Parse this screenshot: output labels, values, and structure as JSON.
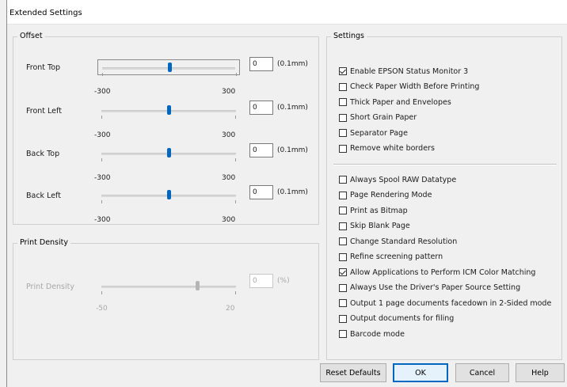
{
  "window": {
    "title": "Extended Settings"
  },
  "offset": {
    "group_label": "Offset",
    "rows": [
      {
        "label": "Front Top",
        "value": "0",
        "unit": "(0.1mm)",
        "min": "-300",
        "max": "300",
        "level": 0.5
      },
      {
        "label": "Front Left",
        "value": "0",
        "unit": "(0.1mm)",
        "min": "-300",
        "max": "300",
        "level": 0.5
      },
      {
        "label": "Back Top",
        "value": "0",
        "unit": "(0.1mm)",
        "min": "-300",
        "max": "300",
        "level": 0.5
      },
      {
        "label": "Back Left",
        "value": "0",
        "unit": "(0.1mm)",
        "min": "-300",
        "max": "300",
        "level": 0.5
      }
    ]
  },
  "print_density": {
    "group_label": "Print Density",
    "label": "Print Density",
    "value": "0",
    "unit": "(%)",
    "min": "-50",
    "max": "20",
    "level": 0.714
  },
  "settings": {
    "group_label": "Settings",
    "group1": [
      {
        "label": "Enable EPSON Status Monitor 3",
        "checked": true
      },
      {
        "label": "Check Paper Width Before Printing",
        "checked": false
      },
      {
        "label": "Thick Paper and Envelopes",
        "checked": false
      },
      {
        "label": "Short Grain Paper",
        "checked": false
      },
      {
        "label": "Separator Page",
        "checked": false
      },
      {
        "label": "Remove white borders",
        "checked": false
      }
    ],
    "group2": [
      {
        "label": "Always Spool RAW Datatype",
        "checked": false
      },
      {
        "label": "Page Rendering Mode",
        "checked": false
      },
      {
        "label": "Print as Bitmap",
        "checked": false
      },
      {
        "label": "Skip Blank Page",
        "checked": false
      },
      {
        "label": "Change Standard Resolution",
        "checked": false
      },
      {
        "label": "Refine screening pattern",
        "checked": false
      },
      {
        "label": "Allow Applications to Perform ICM Color Matching",
        "checked": true
      },
      {
        "label": "Always Use the Driver's Paper Source Setting",
        "checked": false
      },
      {
        "label": "Output 1 page documents facedown in 2-Sided mode",
        "checked": false
      },
      {
        "label": "Output documents for filing",
        "checked": false
      },
      {
        "label": "Barcode mode",
        "checked": false
      }
    ]
  },
  "buttons": {
    "reset": "Reset Defaults",
    "ok": "OK",
    "cancel": "Cancel",
    "help": "Help"
  },
  "colors": {
    "accent": "#0067c0",
    "disabled": "#a8a8a8"
  }
}
